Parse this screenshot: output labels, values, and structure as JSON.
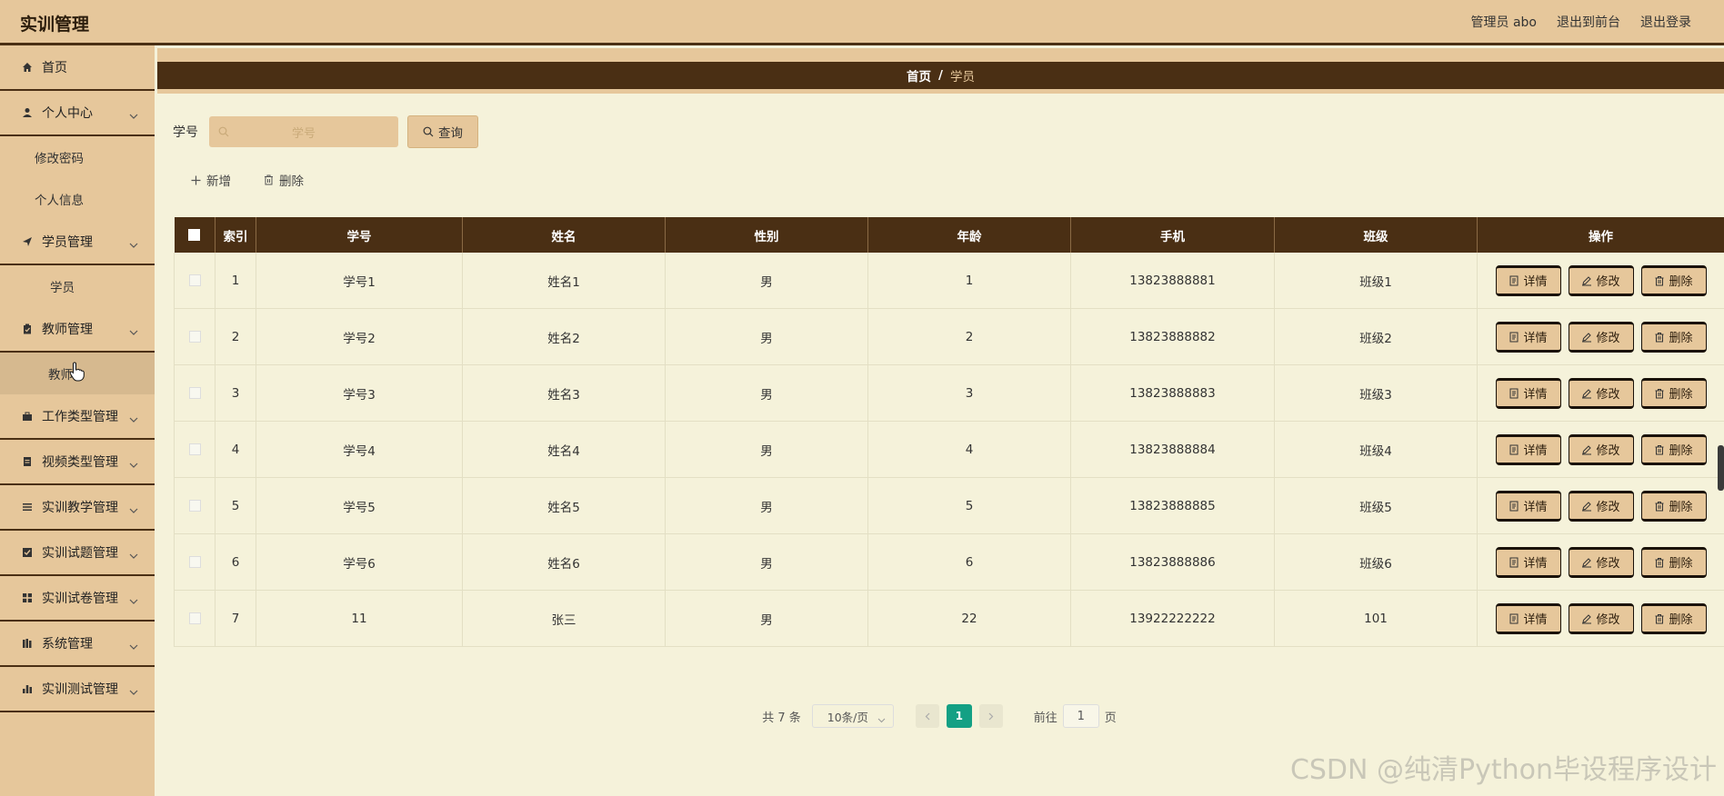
{
  "header": {
    "title": "实训管理",
    "user_label": "管理员 abo",
    "to_front": "退出到前台",
    "logout": "退出登录"
  },
  "sidebar": {
    "home": "首页",
    "personal": "个人中心",
    "change_password": "修改密码",
    "personal_info": "个人信息",
    "student_mgmt": "学员管理",
    "student": "学员",
    "teacher_mgmt": "教师管理",
    "teacher": "教师",
    "work_type_mgmt": "工作类型管理",
    "video_type_mgmt": "视频类型管理",
    "teaching_mgmt": "实训教学管理",
    "question_mgmt": "实训试题管理",
    "paper_mgmt": "实训试卷管理",
    "system_mgmt": "系统管理",
    "test_mgmt": "实训测试管理"
  },
  "breadcrumb": {
    "home": "首页",
    "sep": "/",
    "current": "学员"
  },
  "search": {
    "label": "学号",
    "placeholder": "学号",
    "button": "查询"
  },
  "actions": {
    "add": "新增",
    "delete": "删除"
  },
  "table": {
    "columns": [
      "索引",
      "学号",
      "姓名",
      "性别",
      "年龄",
      "手机",
      "班级",
      "操作"
    ],
    "rows": [
      [
        "1",
        "学号1",
        "姓名1",
        "男",
        "1",
        "13823888881",
        "班级1"
      ],
      [
        "2",
        "学号2",
        "姓名2",
        "男",
        "2",
        "13823888882",
        "班级2"
      ],
      [
        "3",
        "学号3",
        "姓名3",
        "男",
        "3",
        "13823888883",
        "班级3"
      ],
      [
        "4",
        "学号4",
        "姓名4",
        "男",
        "4",
        "13823888884",
        "班级4"
      ],
      [
        "5",
        "学号5",
        "姓名5",
        "男",
        "5",
        "13823888885",
        "班级5"
      ],
      [
        "6",
        "学号6",
        "姓名6",
        "男",
        "6",
        "13823888886",
        "班级6"
      ],
      [
        "7",
        "11",
        "张三",
        "男",
        "22",
        "13922222222",
        "101"
      ]
    ],
    "op_detail": "详情",
    "op_edit": "修改",
    "op_delete": "删除"
  },
  "pagination": {
    "total": "共 7 条",
    "page_size": "10条/页",
    "current_page": "1",
    "goto_label": "前往",
    "goto_value": "1",
    "page_suffix": "页"
  },
  "watermark": "CSDN @纯清Python毕设程序设计",
  "colors": {
    "accent": "#e6c79b",
    "dark": "#4a2f14",
    "background": "#f5f2da",
    "page_active": "#13a084"
  }
}
